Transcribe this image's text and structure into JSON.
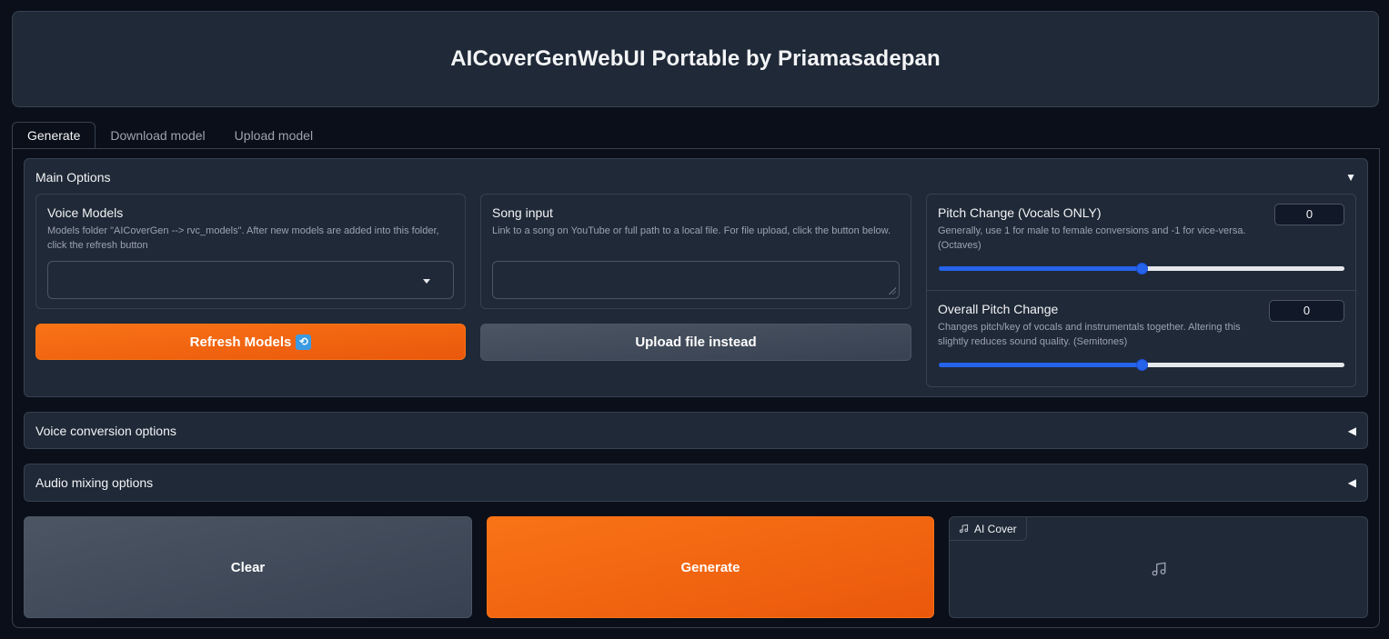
{
  "header": {
    "title": "AICoverGenWebUI Portable by Priamasadepan"
  },
  "tabs": [
    {
      "label": "Generate",
      "active": true
    },
    {
      "label": "Download model",
      "active": false
    },
    {
      "label": "Upload model",
      "active": false
    }
  ],
  "main_options": {
    "title": "Main Options",
    "voice_models": {
      "label": "Voice Models",
      "info": "Models folder \"AICoverGen --> rvc_models\". After new models are added into this folder, click the refresh button",
      "selected": ""
    },
    "song_input": {
      "label": "Song input",
      "info": "Link to a song on YouTube or full path to a local file. For file upload, click the button below.",
      "value": ""
    },
    "refresh_button": "Refresh Models",
    "refresh_emoji": "🔁",
    "upload_button": "Upload file instead",
    "pitch_change": {
      "label": "Pitch Change (Vocals ONLY)",
      "info": "Generally, use 1 for male to female conversions and -1 for vice-versa. (Octaves)",
      "value": "0",
      "level": 0.5
    },
    "overall_pitch": {
      "label": "Overall Pitch Change",
      "info": "Changes pitch/key of vocals and instrumentals together. Altering this slightly reduces sound quality. (Semitones)",
      "value": "0",
      "level": 0.5
    }
  },
  "voice_conversion": {
    "title": "Voice conversion options"
  },
  "audio_mixing": {
    "title": "Audio mixing options"
  },
  "actions": {
    "clear": "Clear",
    "generate": "Generate"
  },
  "output": {
    "label": "AI Cover"
  },
  "icons": {
    "collapse_open": "triangle-down-icon",
    "collapse_closed": "triangle-left-icon",
    "music": "music-note-icon"
  },
  "colors": {
    "accent": "#f97316",
    "slider": "#2563eb",
    "background": "#0b0f19",
    "panel": "#1f2937"
  }
}
